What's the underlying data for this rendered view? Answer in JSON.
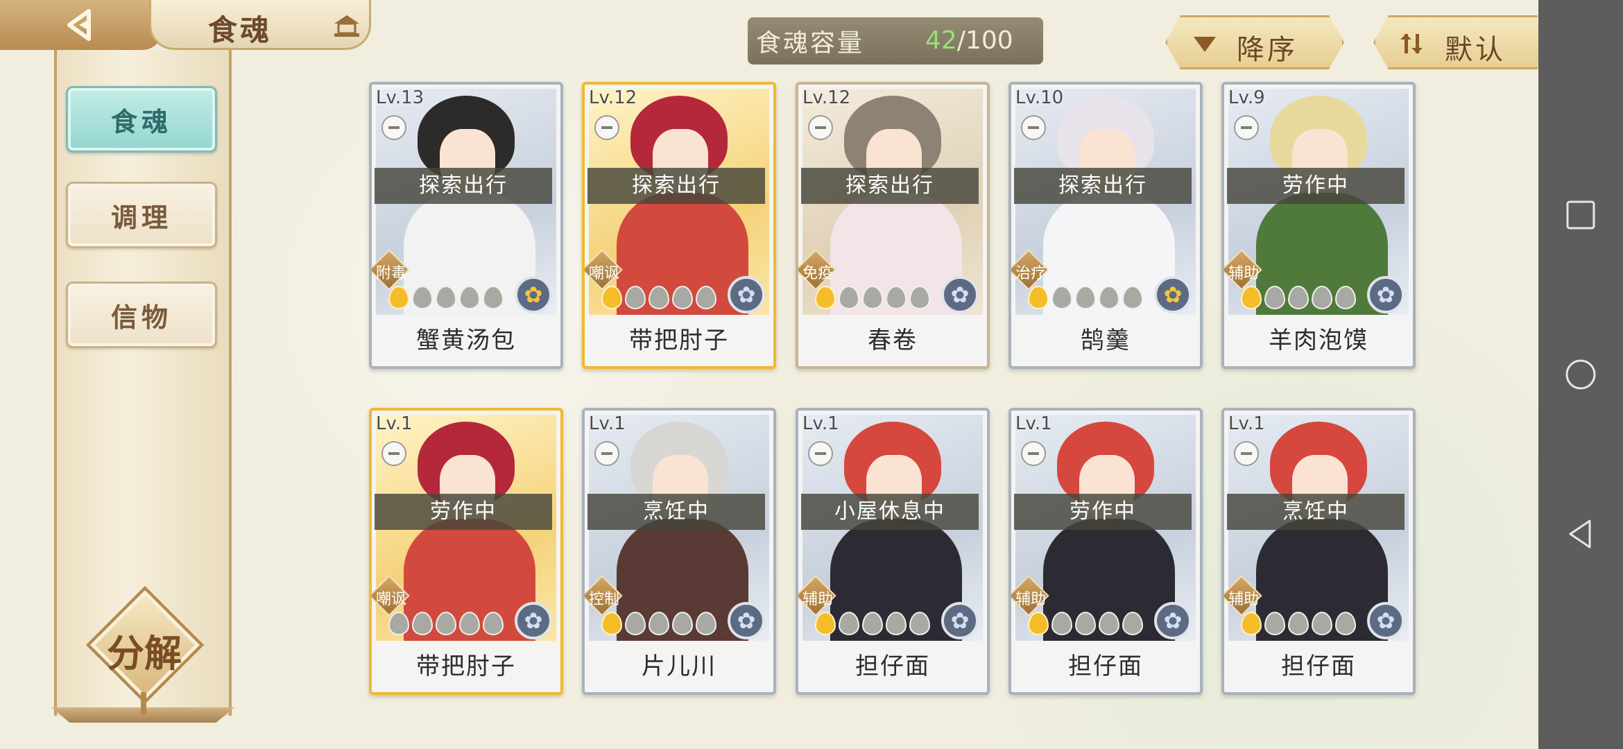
{
  "header": {
    "title": "食魂",
    "capacity_label": "食魂容量",
    "capacity_current": "42",
    "capacity_total": "/100",
    "sort_order_label": "降序",
    "sort_mode_label": "默认"
  },
  "sidebar": {
    "items": [
      {
        "label": "食魂",
        "active": true
      },
      {
        "label": "调理",
        "active": false
      },
      {
        "label": "信物",
        "active": false
      }
    ],
    "decompose_label": "分解"
  },
  "colors": {
    "accent_gold": "#f0b930",
    "active_tab": "#93d6cf",
    "capacity_highlight": "#8fe06e"
  },
  "cards": [
    {
      "level": "Lv.13",
      "status": "探索出行",
      "role": "附毒",
      "name": "蟹黄汤包",
      "frame": "silver",
      "stars_on": 1,
      "emblem": "gold-flower-icon",
      "hair": "#2d2a2a",
      "body": "#f2f2f2"
    },
    {
      "level": "Lv.12",
      "status": "探索出行",
      "role": "嘲讽",
      "name": "带把肘子",
      "frame": "gold",
      "stars_on": 1,
      "emblem": "blue-flower-icon",
      "hair": "#b4283a",
      "body": "#d24a3e"
    },
    {
      "level": "Lv.12",
      "status": "探索出行",
      "role": "免疫",
      "name": "春卷",
      "frame": "tan",
      "stars_on": 1,
      "emblem": "blue-flower-icon",
      "hair": "#8d8273",
      "body": "#f3e4e8"
    },
    {
      "level": "Lv.10",
      "status": "探索出行",
      "role": "治疗",
      "name": "鹄羹",
      "frame": "silver",
      "stars_on": 1,
      "emblem": "gold-flower-icon",
      "hair": "#e8e3ea",
      "body": "#f5f5f8"
    },
    {
      "level": "Lv.9",
      "status": "劳作中",
      "role": "辅助",
      "name": "羊肉泡馍",
      "frame": "silver",
      "stars_on": 1,
      "emblem": "blue-flower-icon",
      "hair": "#e7d99c",
      "body": "#4f7a3c"
    },
    {
      "level": "Lv.1",
      "status": "劳作中",
      "role": "嘲讽",
      "name": "带把肘子",
      "frame": "gold",
      "stars_on": 0,
      "emblem": "blue-flower-icon",
      "hair": "#b4283a",
      "body": "#d24a3e"
    },
    {
      "level": "Lv.1",
      "status": "烹饪中",
      "role": "控制",
      "name": "片儿川",
      "frame": "silver",
      "stars_on": 1,
      "emblem": "blue-flower-icon",
      "hair": "#d8d6d3",
      "body": "#5a3a34"
    },
    {
      "level": "Lv.1",
      "status": "小屋休息中",
      "role": "辅助",
      "name": "担仔面",
      "frame": "silver",
      "stars_on": 1,
      "emblem": "blue-flower-icon",
      "hair": "#d6473d",
      "body": "#2c2a33"
    },
    {
      "level": "Lv.1",
      "status": "劳作中",
      "role": "辅助",
      "name": "担仔面",
      "frame": "silver",
      "stars_on": 1,
      "emblem": "blue-flower-icon",
      "hair": "#d6473d",
      "body": "#2c2a33"
    },
    {
      "level": "Lv.1",
      "status": "烹饪中",
      "role": "辅助",
      "name": "担仔面",
      "frame": "silver",
      "stars_on": 1,
      "emblem": "blue-flower-icon",
      "hair": "#d6473d",
      "body": "#2c2a33"
    }
  ]
}
